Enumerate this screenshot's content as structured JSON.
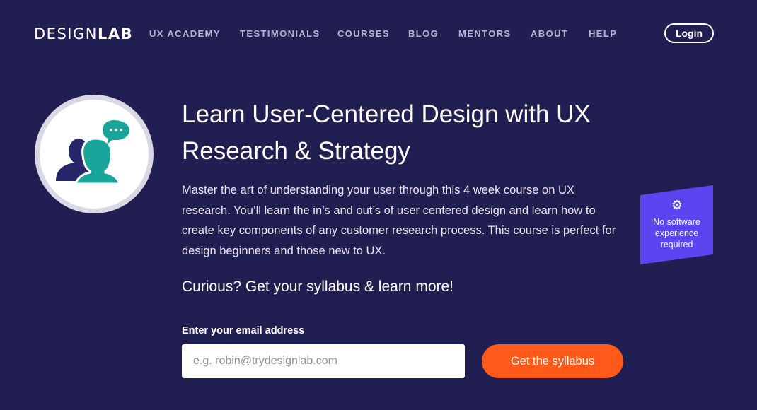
{
  "brand": {
    "logo_light": "DESIGN",
    "logo_bold": "LAB"
  },
  "nav": {
    "items": [
      {
        "label": "UX ACADEMY"
      },
      {
        "label": "TESTIMONIALS"
      },
      {
        "label": "COURSES"
      },
      {
        "label": "BLOG"
      },
      {
        "label": "MENTORS"
      },
      {
        "label": "ABOUT"
      },
      {
        "label": "HELP"
      }
    ],
    "login_label": "Login"
  },
  "hero": {
    "icon": "user-research-people-icon",
    "title": "Learn User-Centered Design with UX Research & Strategy",
    "description": "Master the art of understanding your user through this 4 week course on UX research. You’ll learn the in’s and out’s of user centered design and learn how to create key components of any customer research process. This course is perfect for design beginners and those new to UX.",
    "badge": {
      "icon": "gear-icon",
      "text": "No software experience required"
    },
    "cta_text": "Curious? Get your syllabus & learn more!"
  },
  "signup": {
    "email_label": "Enter your email address",
    "email_placeholder": "e.g. robin@trydesignlab.com",
    "email_value": "",
    "submit_label": "Get the syllabus"
  },
  "colors": {
    "background": "#211f52",
    "accent_orange": "#ff5a1a",
    "badge_purple": "#5a45f0",
    "icon_teal": "#1aa59a",
    "icon_navy": "#28266a"
  }
}
